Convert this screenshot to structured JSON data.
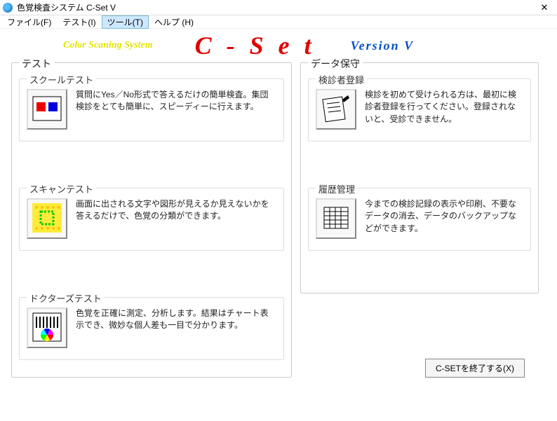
{
  "window": {
    "title": "色覚検査システム C-Set V",
    "close_label": "✕"
  },
  "menu": {
    "file": "ファイル(F)",
    "test": "テスト(I)",
    "tool": "ツール(T)",
    "help": "ヘルプ (H)"
  },
  "banner": {
    "system_name": "Color Scaning System",
    "logo": "C - S e t",
    "version": "Version  V"
  },
  "groups": {
    "test": {
      "legend": "テスト",
      "school": {
        "legend": "スクールテスト",
        "desc": "質問にYes／No形式で答えるだけの簡単検査。集団検診をとても簡単に、スピーディーに行えます。"
      },
      "scan": {
        "legend": "スキャンテスト",
        "desc": "画面に出される文字や図形が見えるか見えないかを答えるだけで、色覚の分類ができます。"
      },
      "doctor": {
        "legend": "ドクターズテスト",
        "desc": "色覚を正確に測定、分析します。結果はチャート表示でき、微妙な個人差も一目で分かります。"
      }
    },
    "data": {
      "legend": "データ保守",
      "register": {
        "legend": "検診者登録",
        "desc": "検診を初めて受けられる方は、最初に検診者登録を行ってください。登録されないと、受診できません。"
      },
      "history": {
        "legend": "履歴管理",
        "desc": "今までの検診記録の表示や印刷、不要なデータの消去、データのバックアップなどができます。"
      }
    }
  },
  "exit_button": "C-SETを終了する(X)"
}
